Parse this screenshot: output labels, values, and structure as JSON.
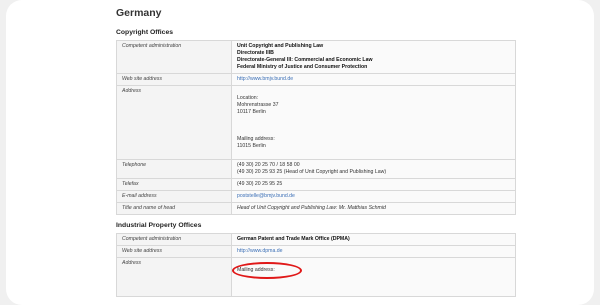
{
  "country": "Germany",
  "copyright": {
    "title": "Copyright Offices",
    "rows": {
      "admin_label": "Competent administration",
      "admin_lines": [
        "Unit Copyright and Publishing Law",
        "Directorate IIIB",
        "Directorate-General III: Commercial and Economic Law",
        "Federal Ministry of Justice and Consumer Protection"
      ],
      "web_label": "Web site address",
      "web_value": "http://www.bmjv.bund.de",
      "address_label": "Address",
      "address_lines": [
        "Location:",
        "Mohrenstrasse 37",
        "10117 Berlin",
        "Mailing address:",
        "11015 Berlin"
      ],
      "telephone_label": "Telephone",
      "telephone_lines": [
        "(49 30) 20 25 70 / 18 58 00",
        "(49 30) 20 25 93 25 (Head of Unit Copyright and Publishing Law)"
      ],
      "telefax_label": "Telefax",
      "telefax_value": "(49 30) 20 25 95 25",
      "email_label": "E-mail address",
      "email_value": "poststelle@bmjv.bund.de",
      "head_label": "Title and name of head",
      "head_value": "Head of Unit Copyright and Publishing Law: Mr. Matthias Schmid"
    }
  },
  "industrial": {
    "title": "Industrial Property Offices",
    "rows": {
      "admin_label": "Competent administration",
      "admin_value": "German Patent and Trade Mark Office (DPMA)",
      "web_label": "Web site address",
      "web_value": "http://www.dpma.de",
      "address_label": "Address",
      "address_first": "Mailing address:"
    }
  },
  "accent_colors": {
    "link": "#3b6fb6",
    "highlight_circle": "#e01818"
  }
}
